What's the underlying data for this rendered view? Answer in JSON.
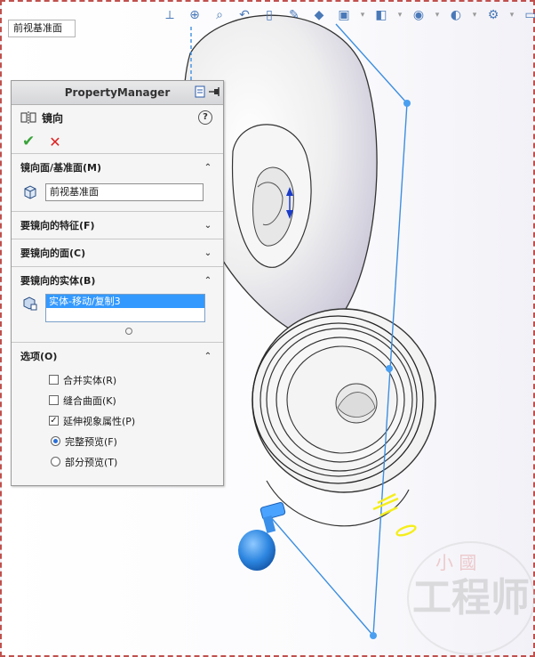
{
  "plane_label": "前视基准面",
  "property_manager": {
    "header_title": "PropertyManager",
    "feature_title": "镜向",
    "help_glyph": "?",
    "sections": {
      "mirror_plane": {
        "label": "镜向面/基准面(M)",
        "value": "前视基准面"
      },
      "features": {
        "label": "要镜向的特征(F)"
      },
      "faces": {
        "label": "要镜向的面(C)"
      },
      "bodies": {
        "label": "要镜向的实体(B)",
        "selected": "实体-移动/复制3"
      },
      "options": {
        "label": "选项(O)",
        "merge_solids": {
          "label": "合并实体(R)",
          "checked": false
        },
        "knit_surfaces": {
          "label": "缝合曲面(K)",
          "checked": false
        },
        "propagate_visual": {
          "label": "延伸视象属性(P)",
          "checked": true
        },
        "full_preview": {
          "label": "完整预览(F)",
          "selected": true
        },
        "partial_preview": {
          "label": "部分预览(T)",
          "selected": false
        }
      }
    }
  },
  "watermark": {
    "big": "工程师",
    "small": "小 國"
  },
  "colors": {
    "accent_blue": "#3399ff",
    "ok_green": "#3aa33a",
    "cancel_red": "#dd2222",
    "preview_yellow": "#f5ee1a"
  }
}
